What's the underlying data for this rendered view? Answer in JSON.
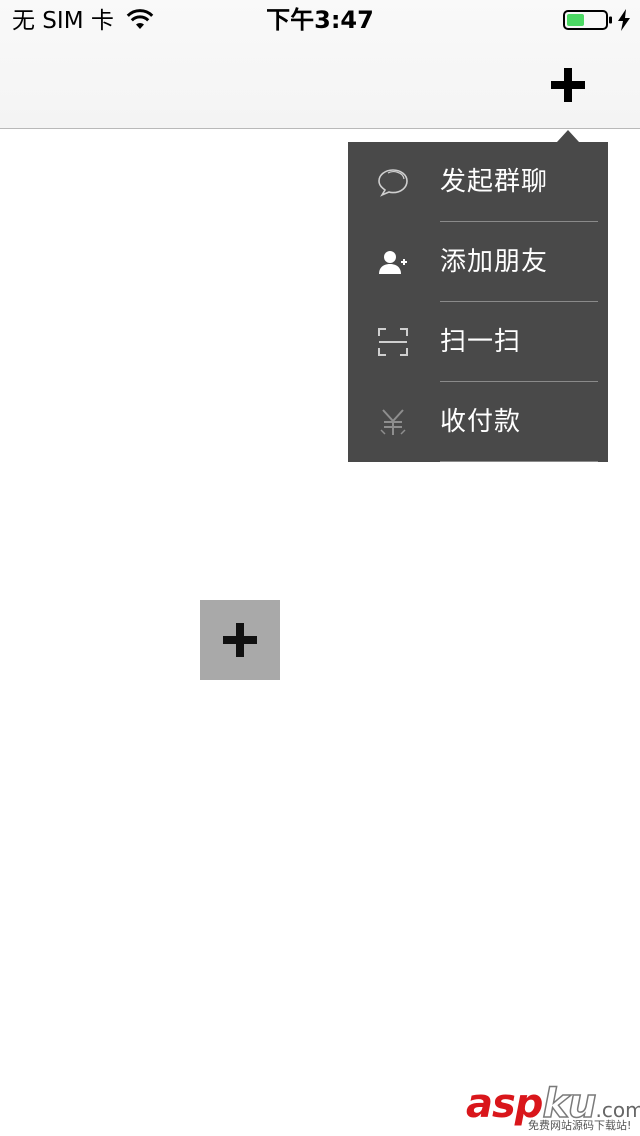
{
  "status_bar": {
    "carrier": "无 SIM 卡",
    "time": "下午3:47",
    "battery_color": "#4cd964"
  },
  "nav_bar": {
    "right_button_icon": "plus-icon"
  },
  "popover_menu": {
    "background": "#494949",
    "items": [
      {
        "label": "发起群聊",
        "icon": "chat-bubble-icon"
      },
      {
        "label": "添加朋友",
        "icon": "add-friend-icon"
      },
      {
        "label": "扫一扫",
        "icon": "scan-icon"
      },
      {
        "label": "收付款",
        "icon": "payment-icon"
      }
    ]
  },
  "center_button": {
    "icon": "plus-icon",
    "background": "#a9a9a9"
  },
  "watermark": {
    "brand_part1": "asp",
    "brand_part2": "ku",
    "brand_suffix": ".com",
    "tagline": "免费网站源码下载站!"
  }
}
